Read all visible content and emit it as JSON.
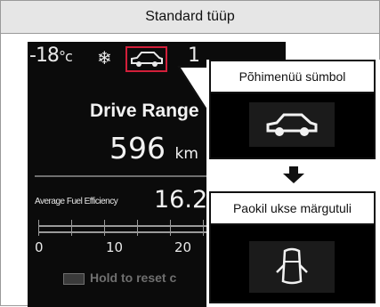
{
  "header": {
    "title": "Standard tüüp"
  },
  "display": {
    "temperature": "-18",
    "temperature_unit": "°c",
    "snow_icon": "snowflake-icon",
    "top_number": "1",
    "range_label": "Drive Range",
    "range_value": "596",
    "range_unit": "km",
    "fuel_label": "Average Fuel Efficiency",
    "fuel_value": "16.2",
    "scale_labels": [
      "0",
      "10",
      "20"
    ],
    "hold_text": "Hold  to reset c",
    "highlight_color": "#d21f3a"
  },
  "callout": {
    "main_menu_title": "Põhimenüü sümbol",
    "door_warning_title": "Paokil ukse märgutuli"
  }
}
